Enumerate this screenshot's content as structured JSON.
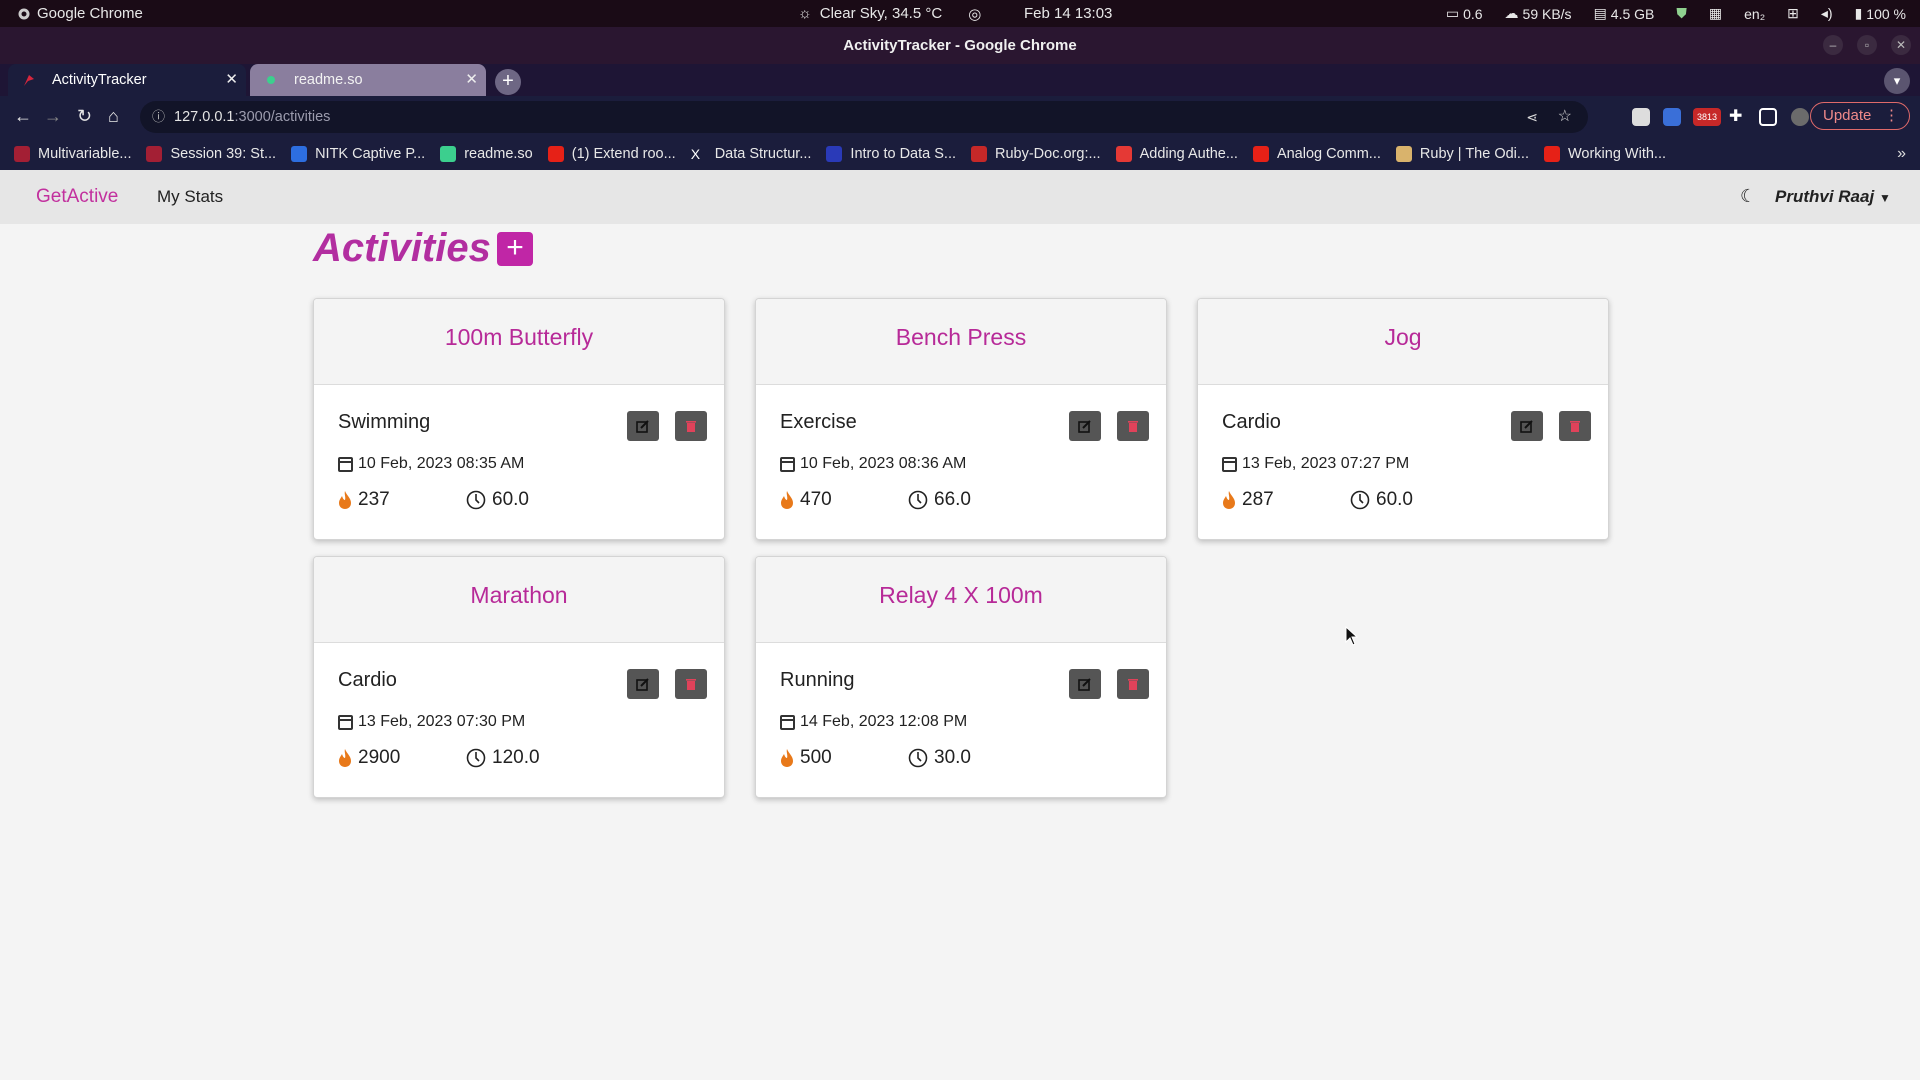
{
  "os_bar": {
    "app_name": "Google Chrome",
    "weather": "Clear Sky, 34.5 °C",
    "clock": "Feb 14  13:03",
    "load": "0.6",
    "network": "59 KB/s",
    "memory": "4.5 GB",
    "language": "en₂",
    "battery": "100 %"
  },
  "window": {
    "title": "ActivityTracker - Google Chrome"
  },
  "tabs": [
    {
      "label": "ActivityTracker",
      "active": true
    },
    {
      "label": "readme.so",
      "active": false
    }
  ],
  "address": {
    "host": "127.0.0.1",
    "path": ":3000/activities",
    "update_label": "Update",
    "badge": "3813"
  },
  "bookmarks": [
    {
      "label": "Multivariable...",
      "icon": "mit-icon"
    },
    {
      "label": "Session 39: St...",
      "icon": "mit-icon"
    },
    {
      "label": "NITK Captive P...",
      "icon": "s-icon"
    },
    {
      "label": "readme.so",
      "icon": "readme-icon"
    },
    {
      "label": "(1) Extend roo...",
      "icon": "youtube-icon"
    },
    {
      "label": "Data Structur...",
      "icon": "x-icon"
    },
    {
      "label": "Intro to Data S...",
      "icon": "u-icon"
    },
    {
      "label": "Ruby-Doc.org:...",
      "icon": "ruby-icon"
    },
    {
      "label": "Adding Authe...",
      "icon": "heart-icon"
    },
    {
      "label": "Analog Comm...",
      "icon": "youtube-icon"
    },
    {
      "label": "Ruby | The Odi...",
      "icon": "odin-icon"
    },
    {
      "label": "Working With...",
      "icon": "youtube-icon"
    }
  ],
  "navbar": {
    "brand": "GetActive",
    "my_stats": "My Stats",
    "user": "Pruthvi Raaj"
  },
  "page": {
    "heading": "Activities",
    "add_label": "+"
  },
  "activities": [
    {
      "title": "100m Butterfly",
      "type": "Swimming",
      "date": "10 Feb, 2023 08:35 AM",
      "calories": "237",
      "duration": "60.0"
    },
    {
      "title": "Bench Press",
      "type": "Exercise",
      "date": "10 Feb, 2023 08:36 AM",
      "calories": "470",
      "duration": "66.0"
    },
    {
      "title": "Jog",
      "type": "Cardio",
      "date": "13 Feb, 2023 07:27 PM",
      "calories": "287",
      "duration": "60.0"
    },
    {
      "title": "Marathon",
      "type": "Cardio",
      "date": "13 Feb, 2023 07:30 PM",
      "calories": "2900",
      "duration": "120.0"
    },
    {
      "title": "Relay 4 X 100m",
      "type": "Running",
      "date": "14 Feb, 2023 12:08 PM",
      "calories": "500",
      "duration": "30.0"
    }
  ],
  "colors": {
    "accent": "#c2309e",
    "card_title": "#b72a98",
    "flame": "#e8791a",
    "delete_icon": "#e0425a"
  }
}
